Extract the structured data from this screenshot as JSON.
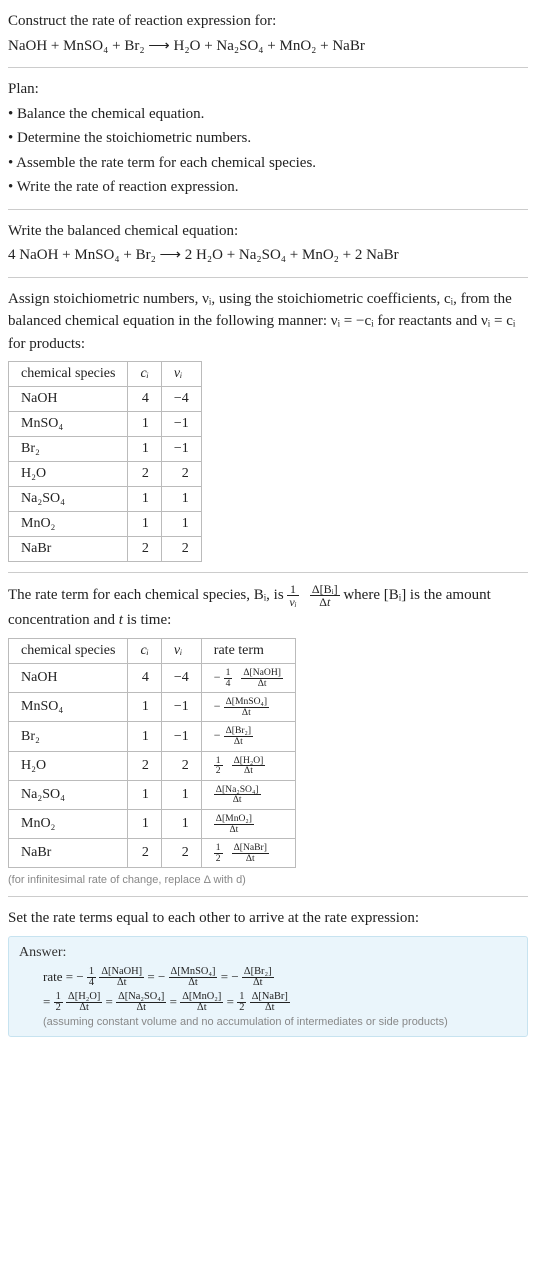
{
  "intro": {
    "prompt": "Construct the rate of reaction expression for:",
    "equation_lhs": "NaOH + MnSO",
    "equation_rhs_full": "NaOH + MnSO₄ + Br₂  ⟶  H₂O + Na₂SO₄ + MnO₂ + NaBr"
  },
  "plan": {
    "heading": "Plan:",
    "items": [
      "• Balance the chemical equation.",
      "• Determine the stoichiometric numbers.",
      "• Assemble the rate term for each chemical species.",
      "• Write the rate of reaction expression."
    ]
  },
  "balanced": {
    "heading": "Write the balanced chemical equation:",
    "equation": "4 NaOH + MnSO₄ + Br₂  ⟶  2 H₂O + Na₂SO₄ + MnO₂ + 2 NaBr"
  },
  "assign": {
    "text": "Assign stoichiometric numbers, νᵢ, using the stoichiometric coefficients, cᵢ, from the balanced chemical equation in the following manner: νᵢ = −cᵢ for reactants and νᵢ = cᵢ for products:"
  },
  "table1": {
    "headers": [
      "chemical species",
      "cᵢ",
      "νᵢ"
    ],
    "rows": [
      {
        "species": "NaOH",
        "c": "4",
        "v": "−4"
      },
      {
        "species": "MnSO₄",
        "c": "1",
        "v": "−1"
      },
      {
        "species": "Br₂",
        "c": "1",
        "v": "−1"
      },
      {
        "species": "H₂O",
        "c": "2",
        "v": "2"
      },
      {
        "species": "Na₂SO₄",
        "c": "1",
        "v": "1"
      },
      {
        "species": "MnO₂",
        "c": "1",
        "v": "1"
      },
      {
        "species": "NaBr",
        "c": "2",
        "v": "2"
      }
    ]
  },
  "rateterm_intro": {
    "prefix": "The rate term for each chemical species, Bᵢ, is ",
    "mid": " where [Bᵢ] is the amount concentration and ",
    "tvar": "t",
    "suffix": " is time:"
  },
  "table2": {
    "headers": [
      "chemical species",
      "cᵢ",
      "νᵢ",
      "rate term"
    ],
    "rows": [
      {
        "species": "NaOH",
        "c": "4",
        "v": "−4",
        "term_prefix": "−",
        "term_frac1_top": "1",
        "term_frac1_bot": "4",
        "term_frac2_top": "Δ[NaOH]",
        "term_frac2_bot": "Δt"
      },
      {
        "species": "MnSO₄",
        "c": "1",
        "v": "−1",
        "term_prefix": "−",
        "term_frac1_top": "",
        "term_frac1_bot": "",
        "term_frac2_top": "Δ[MnSO₄]",
        "term_frac2_bot": "Δt"
      },
      {
        "species": "Br₂",
        "c": "1",
        "v": "−1",
        "term_prefix": "−",
        "term_frac1_top": "",
        "term_frac1_bot": "",
        "term_frac2_top": "Δ[Br₂]",
        "term_frac2_bot": "Δt"
      },
      {
        "species": "H₂O",
        "c": "2",
        "v": "2",
        "term_prefix": "",
        "term_frac1_top": "1",
        "term_frac1_bot": "2",
        "term_frac2_top": "Δ[H₂O]",
        "term_frac2_bot": "Δt"
      },
      {
        "species": "Na₂SO₄",
        "c": "1",
        "v": "1",
        "term_prefix": "",
        "term_frac1_top": "",
        "term_frac1_bot": "",
        "term_frac2_top": "Δ[Na₂SO₄]",
        "term_frac2_bot": "Δt"
      },
      {
        "species": "MnO₂",
        "c": "1",
        "v": "1",
        "term_prefix": "",
        "term_frac1_top": "",
        "term_frac1_bot": "",
        "term_frac2_top": "Δ[MnO₂]",
        "term_frac2_bot": "Δt"
      },
      {
        "species": "NaBr",
        "c": "2",
        "v": "2",
        "term_prefix": "",
        "term_frac1_top": "1",
        "term_frac1_bot": "2",
        "term_frac2_top": "Δ[NaBr]",
        "term_frac2_bot": "Δt"
      }
    ],
    "note": "(for infinitesimal rate of change, replace Δ with d)"
  },
  "final": {
    "heading": "Set the rate terms equal to each other to arrive at the rate expression:"
  },
  "answer": {
    "label": "Answer:",
    "line1_prefix": "rate = −",
    "eq": " = ",
    "minus": "−",
    "f_1_4_top": "1",
    "f_1_4_bot": "4",
    "f_1_2_top": "1",
    "f_1_2_bot": "2",
    "d_naoh_top": "Δ[NaOH]",
    "d_naoh_bot": "Δt",
    "d_mnso4_top": "Δ[MnSO₄]",
    "d_mnso4_bot": "Δt",
    "d_br2_top": "Δ[Br₂]",
    "d_br2_bot": "Δt",
    "d_h2o_top": "Δ[H₂O]",
    "d_h2o_bot": "Δt",
    "d_na2so4_top": "Δ[Na₂SO₄]",
    "d_na2so4_bot": "Δt",
    "d_mno2_top": "Δ[MnO₂]",
    "d_mno2_bot": "Δt",
    "d_nabr_top": "Δ[NaBr]",
    "d_nabr_bot": "Δt",
    "line2_prefix": "= ",
    "note": "(assuming constant volume and no accumulation of intermediates or side products)"
  },
  "chart_data": {
    "type": "table",
    "tables": [
      {
        "title": "stoichiometric numbers",
        "columns": [
          "chemical species",
          "cᵢ",
          "νᵢ"
        ],
        "rows": [
          [
            "NaOH",
            4,
            -4
          ],
          [
            "MnSO₄",
            1,
            -1
          ],
          [
            "Br₂",
            1,
            -1
          ],
          [
            "H₂O",
            2,
            2
          ],
          [
            "Na₂SO₄",
            1,
            1
          ],
          [
            "MnO₂",
            1,
            1
          ],
          [
            "NaBr",
            2,
            2
          ]
        ]
      },
      {
        "title": "rate terms",
        "columns": [
          "chemical species",
          "cᵢ",
          "νᵢ",
          "rate term"
        ],
        "rows": [
          [
            "NaOH",
            4,
            -4,
            "-(1/4) Δ[NaOH]/Δt"
          ],
          [
            "MnSO₄",
            1,
            -1,
            "-Δ[MnSO₄]/Δt"
          ],
          [
            "Br₂",
            1,
            -1,
            "-Δ[Br₂]/Δt"
          ],
          [
            "H₂O",
            2,
            2,
            "(1/2) Δ[H₂O]/Δt"
          ],
          [
            "Na₂SO₄",
            1,
            1,
            "Δ[Na₂SO₄]/Δt"
          ],
          [
            "MnO₂",
            1,
            1,
            "Δ[MnO₂]/Δt"
          ],
          [
            "NaBr",
            2,
            2,
            "(1/2) Δ[NaBr]/Δt"
          ]
        ]
      }
    ]
  }
}
